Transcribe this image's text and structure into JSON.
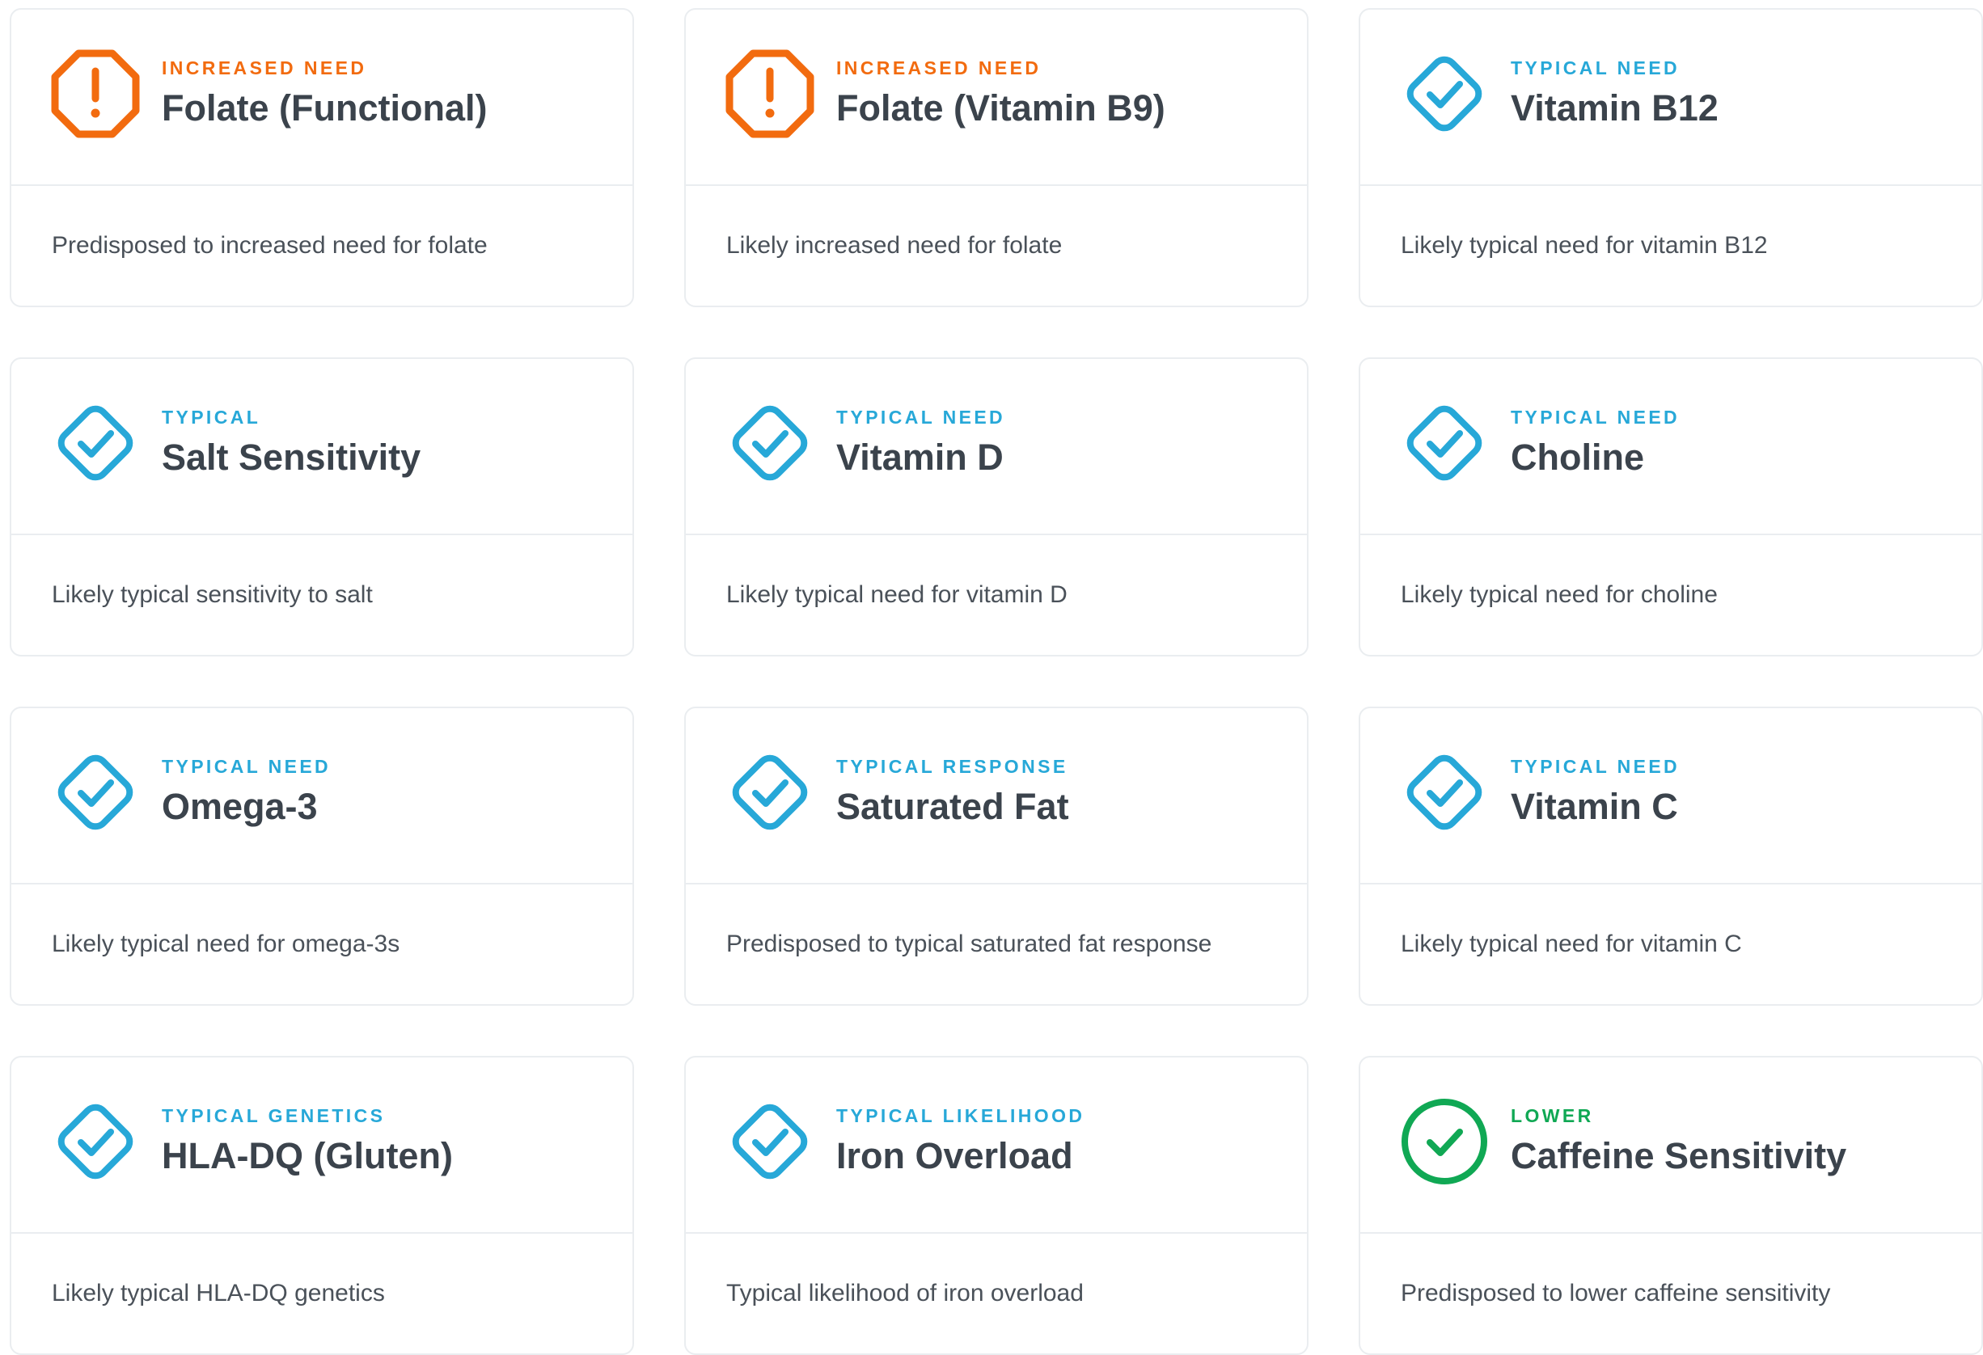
{
  "colors": {
    "warning": "#f26b0f",
    "typical": "#27a8d8",
    "lower": "#10a854",
    "title_text": "#3b434c",
    "body_text": "#4a5159",
    "border": "#eaedf0"
  },
  "cards": [
    {
      "status": "INCREASED NEED",
      "title": "Folate (Functional)",
      "description": "Predisposed to increased need for folate",
      "icon": "exclamation-octagon-icon"
    },
    {
      "status": "INCREASED NEED",
      "title": "Folate (Vitamin B9)",
      "description": "Likely increased need for folate",
      "icon": "exclamation-octagon-icon"
    },
    {
      "status": "TYPICAL NEED",
      "title": "Vitamin B12",
      "description": "Likely typical need for vitamin B12",
      "icon": "check-diamond-icon"
    },
    {
      "status": "TYPICAL",
      "title": "Salt Sensitivity",
      "description": "Likely typical sensitivity to salt",
      "icon": "check-diamond-icon"
    },
    {
      "status": "TYPICAL NEED",
      "title": "Vitamin D",
      "description": "Likely typical need for vitamin D",
      "icon": "check-diamond-icon"
    },
    {
      "status": "TYPICAL NEED",
      "title": "Choline",
      "description": "Likely typical need for choline",
      "icon": "check-diamond-icon"
    },
    {
      "status": "TYPICAL NEED",
      "title": "Omega-3",
      "description": "Likely typical need for omega-3s",
      "icon": "check-diamond-icon"
    },
    {
      "status": "TYPICAL RESPONSE",
      "title": "Saturated Fat",
      "description": "Predisposed to typical saturated fat response",
      "icon": "check-diamond-icon"
    },
    {
      "status": "TYPICAL NEED",
      "title": "Vitamin C",
      "description": "Likely typical need for vitamin C",
      "icon": "check-diamond-icon"
    },
    {
      "status": "TYPICAL GENETICS",
      "title": "HLA-DQ (Gluten)",
      "description": "Likely typical HLA-DQ genetics",
      "icon": "check-diamond-icon"
    },
    {
      "status": "TYPICAL LIKELIHOOD",
      "title": "Iron Overload",
      "description": "Typical likelihood of iron overload",
      "icon": "check-diamond-icon"
    },
    {
      "status": "LOWER",
      "title": "Caffeine Sensitivity",
      "description": "Predisposed to lower caffeine sensitivity",
      "icon": "check-circle-icon"
    }
  ]
}
